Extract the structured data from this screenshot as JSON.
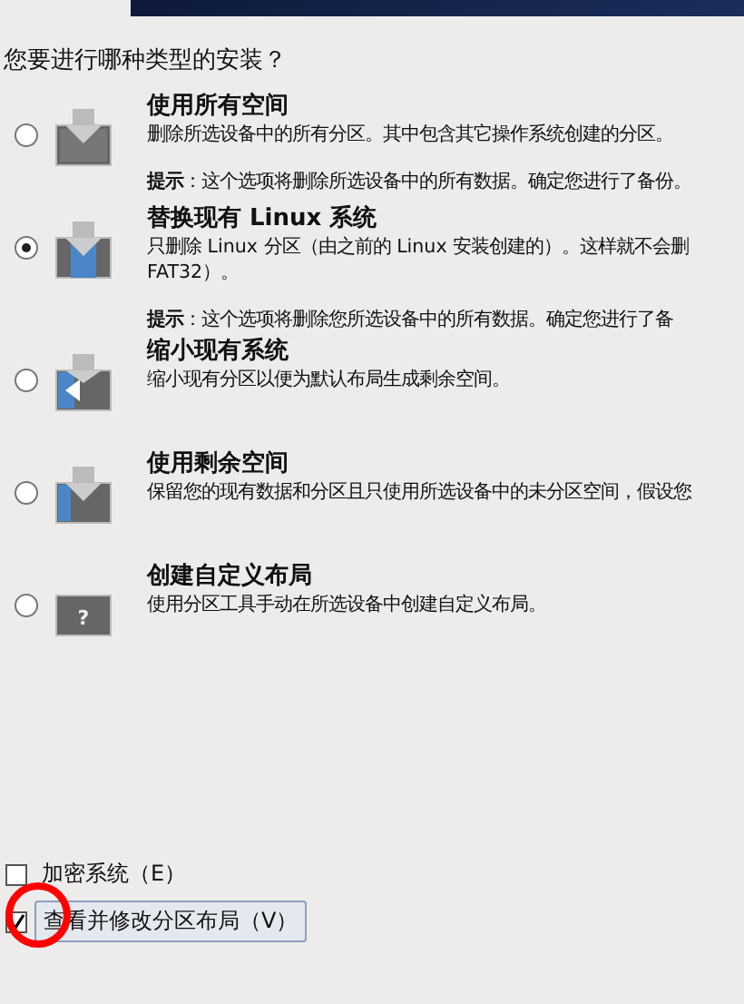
{
  "question": "您要进行哪种类型的安装？",
  "options": [
    {
      "kind": "erase",
      "selected": false,
      "title": "使用所有空间",
      "description": [
        "删除所选设备中的所有分区。其中包含其它操作系统创建的分区。"
      ],
      "hint": "**提示**：这个选项将删除所选设备中的所有数据。确定您进行了备份。"
    },
    {
      "kind": "replace",
      "selected": true,
      "title": "替换现有 Linux 系统",
      "description": [
        "只删除 Linux 分区（由之前的 Linux 安装创建的）。这样就不会删",
        "FAT32）。"
      ],
      "hint": "**提示**：这个选项将删除您所选设备中的所有数据。确定您进行了备"
    },
    {
      "kind": "shrink",
      "selected": false,
      "title": "缩小现有系统",
      "description": [
        "缩小现有分区以便为默认布局生成剩余空间。"
      ]
    },
    {
      "kind": "free",
      "selected": false,
      "title": "使用剩余空间",
      "description": [
        "保留您的现有数据和分区且只使用所选设备中的未分区空间，假设您"
      ]
    },
    {
      "kind": "custom",
      "selected": false,
      "title": "创建自定义布局",
      "description": [
        "使用分区工具手动在所选设备中创建自定义布局。"
      ],
      "icon_text": "?"
    }
  ],
  "checkboxes": [
    {
      "label": "加密系统（E）",
      "checked": false,
      "focused": false
    },
    {
      "label": "查看并修改分区布局（V）",
      "checked": true,
      "focused": true
    }
  ],
  "annotation": {
    "kind": "circle"
  }
}
